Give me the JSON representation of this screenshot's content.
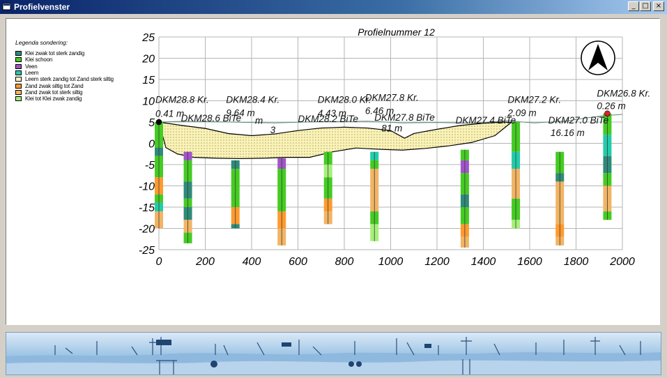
{
  "window": {
    "title": "Profielvenster",
    "minimize_glyph": "_",
    "maximize_glyph": "□",
    "close_glyph": "×",
    "icon": "app-icon"
  },
  "legend": {
    "title": "Legenda sondering:",
    "items": [
      {
        "label": "Klei zwak tot sterk zandig",
        "color": "#2e8b7a"
      },
      {
        "label": "Klei schoon",
        "color": "#44cc22"
      },
      {
        "label": "Veen",
        "color": "#a055c8"
      },
      {
        "label": "Leem",
        "color": "#22ccaa"
      },
      {
        "label": "Leem sterk zandig tot Zand sterk siltig",
        "color": "#fff4c0"
      },
      {
        "label": "Zand zwak siltig tot Zand",
        "color": "#ff9a2e"
      },
      {
        "label": "Zand zwak tot sterk siltig",
        "color": "#f2b464"
      },
      {
        "label": "Klei tot Klei zwak zandig",
        "color": "#a6f07a"
      }
    ]
  },
  "chart_data": {
    "type": "cross-section",
    "title": "Profielnummer 12",
    "xlim": [
      0,
      2000
    ],
    "ylim": [
      -25,
      25
    ],
    "x_ticks": [
      "0",
      "200",
      "400",
      "600",
      "800",
      "1000",
      "1200",
      "1400",
      "1600",
      "1800",
      "2000"
    ],
    "y_ticks": [
      "25",
      "20",
      "15",
      "10",
      "5",
      "0",
      "-5",
      "-10",
      "-15",
      "-20",
      "-25"
    ],
    "grid": true,
    "north_arrow": "north-arrow-icon",
    "labels": [
      {
        "x": -15,
        "y": 9.5,
        "text": "DKM28.8 Kr."
      },
      {
        "x": -15,
        "y": 6.2,
        "text": "0.41 m"
      },
      {
        "x": 95,
        "y": 5.2,
        "text": "DKM28.6 BiTe"
      },
      {
        "x": 290,
        "y": 9.5,
        "text": "DKM28.4 Kr."
      },
      {
        "x": 290,
        "y": 6.4,
        "text": "9.64 m"
      },
      {
        "x": 415,
        "y": 4.6,
        "text": "m"
      },
      {
        "x": 480,
        "y": 2.4,
        "text": "3"
      },
      {
        "x": 600,
        "y": 5.0,
        "text": "DKM28.2 BiTe"
      },
      {
        "x": 685,
        "y": 9.5,
        "text": "DKM28.0 Kr."
      },
      {
        "x": 685,
        "y": 6.3,
        "text": "4.43 m"
      },
      {
        "x": 890,
        "y": 10.0,
        "text": "DKM27.8 Kr."
      },
      {
        "x": 890,
        "y": 6.9,
        "text": "6.46 m"
      },
      {
        "x": 930,
        "y": 5.3,
        "text": "DKM27.8 BiTe"
      },
      {
        "x": 960,
        "y": 2.8,
        "text": "81 m"
      },
      {
        "x": 1280,
        "y": 4.7,
        "text": "DKM27.4 BiTe"
      },
      {
        "x": 1505,
        "y": 9.5,
        "text": "DKM27.2 Kr."
      },
      {
        "x": 1505,
        "y": 6.4,
        "text": "2.09 m"
      },
      {
        "x": 1680,
        "y": 4.7,
        "text": "DKM27.0 BiTe"
      },
      {
        "x": 1690,
        "y": 1.7,
        "text": "16.16 m"
      },
      {
        "x": 1890,
        "y": 11.0,
        "text": "DKM26.8 Kr."
      },
      {
        "x": 1890,
        "y": 8.0,
        "text": "0.26 m"
      }
    ],
    "surface_line": [
      [
        0,
        5
      ],
      [
        120,
        5.2
      ],
      [
        300,
        5
      ],
      [
        500,
        4.8
      ],
      [
        700,
        5.1
      ],
      [
        900,
        5.2
      ],
      [
        1050,
        4.8
      ],
      [
        1200,
        4.9
      ],
      [
        1350,
        4.7
      ],
      [
        1500,
        5.3
      ],
      [
        1620,
        4.8
      ],
      [
        1750,
        5.2
      ],
      [
        1850,
        6
      ],
      [
        1920,
        6.5
      ],
      [
        2000,
        6.8
      ]
    ],
    "cross_section": {
      "fill": "Leem sterk zandig tot Zand sterk siltig",
      "top": [
        [
          0,
          5
        ],
        [
          100,
          4.2
        ],
        [
          200,
          3.5
        ],
        [
          300,
          2.3
        ],
        [
          400,
          1.8
        ],
        [
          500,
          2.2
        ],
        [
          600,
          3.0
        ],
        [
          700,
          3.6
        ],
        [
          800,
          3.8
        ],
        [
          900,
          3.6
        ],
        [
          1000,
          3.0
        ],
        [
          1060,
          1.2
        ],
        [
          1100,
          2.3
        ],
        [
          1200,
          3.3
        ],
        [
          1300,
          4.2
        ],
        [
          1400,
          4.7
        ],
        [
          1480,
          5.0
        ],
        [
          1520,
          4.9
        ]
      ],
      "bottom": [
        [
          1520,
          4.9
        ],
        [
          1450,
          1.8
        ],
        [
          1350,
          0.2
        ],
        [
          1250,
          -0.6
        ],
        [
          1150,
          -1.2
        ],
        [
          1050,
          -1.6
        ],
        [
          950,
          -1.4
        ],
        [
          850,
          -1.1
        ],
        [
          750,
          -2.0
        ],
        [
          650,
          -3.3
        ],
        [
          550,
          -3.3
        ],
        [
          450,
          -3.5
        ],
        [
          350,
          -3.6
        ],
        [
          250,
          -3.5
        ],
        [
          150,
          -3.3
        ],
        [
          80,
          -2.5
        ],
        [
          30,
          -1.0
        ],
        [
          0,
          5
        ]
      ]
    },
    "markers": [
      {
        "x": 0,
        "y": 5,
        "color": "#000000",
        "name": "dkm28-8-marker"
      },
      {
        "x": 1935,
        "y": 7.0,
        "color": "#e02020",
        "name": "dkm26-8-marker"
      }
    ],
    "columns": [
      {
        "name": "dkm28-8-column",
        "x": 0,
        "segments": [
          [
            5,
            -1,
            "#44cc22"
          ],
          [
            -1,
            -3,
            "#2e8b7a"
          ],
          [
            -3,
            -8,
            "#44cc22"
          ],
          [
            -8,
            -12,
            "#ff9a2e"
          ],
          [
            -12,
            -14,
            "#44cc22"
          ],
          [
            -14,
            -16,
            "#22ccaa"
          ],
          [
            -16,
            -20,
            "#f2b464"
          ]
        ]
      },
      {
        "name": "dkm28-6-column",
        "x": 125,
        "segments": [
          [
            -2,
            -4,
            "#a055c8"
          ],
          [
            -4,
            -9,
            "#44cc22"
          ],
          [
            -9,
            -13,
            "#2e8b7a"
          ],
          [
            -13,
            -15,
            "#44cc22"
          ],
          [
            -15,
            -18,
            "#2e8b7a"
          ],
          [
            -18,
            -21,
            "#f2b464"
          ],
          [
            -21,
            -23.5,
            "#44cc22"
          ]
        ]
      },
      {
        "name": "dkm28-4-column",
        "x": 330,
        "segments": [
          [
            -4,
            -6,
            "#2e8b7a"
          ],
          [
            -6,
            -15,
            "#44cc22"
          ],
          [
            -15,
            -19,
            "#ff9a2e"
          ],
          [
            -19,
            -20,
            "#2e8b7a"
          ]
        ]
      },
      {
        "name": "dkm28-2-column",
        "x": 530,
        "segments": [
          [
            -3.5,
            -6,
            "#a055c8"
          ],
          [
            -6,
            -16,
            "#44cc22"
          ],
          [
            -16,
            -20,
            "#ff9a2e"
          ],
          [
            -20,
            -24,
            "#f2b464"
          ]
        ]
      },
      {
        "name": "dkm28-0-column",
        "x": 730,
        "segments": [
          [
            -2,
            -5,
            "#44cc22"
          ],
          [
            -5,
            -8,
            "#a6f07a"
          ],
          [
            -8,
            -13,
            "#44cc22"
          ],
          [
            -13,
            -16,
            "#ff9a2e"
          ],
          [
            -16,
            -19,
            "#f2b464"
          ]
        ]
      },
      {
        "name": "dkm27-8-column",
        "x": 930,
        "segments": [
          [
            -2,
            -4,
            "#22ccaa"
          ],
          [
            -4,
            -6,
            "#44cc22"
          ],
          [
            -6,
            -16,
            "#f2b464"
          ],
          [
            -16,
            -19,
            "#44cc22"
          ],
          [
            -19,
            -23,
            "#a6f07a"
          ]
        ]
      },
      {
        "name": "dkm27-4-column",
        "x": 1320,
        "segments": [
          [
            -1.5,
            -4,
            "#44cc22"
          ],
          [
            -4,
            -7,
            "#a055c8"
          ],
          [
            -7,
            -12,
            "#44cc22"
          ],
          [
            -12,
            -15,
            "#2e8b7a"
          ],
          [
            -15,
            -19,
            "#44cc22"
          ],
          [
            -19,
            -22,
            "#ff9a2e"
          ],
          [
            -22,
            -24.5,
            "#f2b464"
          ]
        ]
      },
      {
        "name": "dkm27-2-column",
        "x": 1540,
        "segments": [
          [
            5,
            -2,
            "#44cc22"
          ],
          [
            -2,
            -6,
            "#22ccaa"
          ],
          [
            -6,
            -13,
            "#f2b464"
          ],
          [
            -13,
            -18,
            "#44cc22"
          ],
          [
            -18,
            -20,
            "#a6f07a"
          ]
        ]
      },
      {
        "name": "dkm27-0-column",
        "x": 1730,
        "segments": [
          [
            -2,
            -7,
            "#44cc22"
          ],
          [
            -7,
            -9,
            "#2e8b7a"
          ],
          [
            -9,
            -19,
            "#f2b464"
          ],
          [
            -19,
            -22,
            "#ff9a2e"
          ],
          [
            -22,
            -24,
            "#f2b464"
          ]
        ]
      },
      {
        "name": "dkm26-8-column",
        "x": 1935,
        "segments": [
          [
            7,
            2,
            "#44cc22"
          ],
          [
            2,
            -3,
            "#22ccaa"
          ],
          [
            -3,
            -7,
            "#2e8b7a"
          ],
          [
            -7,
            -10,
            "#44cc22"
          ],
          [
            -10,
            -16,
            "#f2b464"
          ],
          [
            -16,
            -18,
            "#44cc22"
          ]
        ]
      }
    ]
  }
}
